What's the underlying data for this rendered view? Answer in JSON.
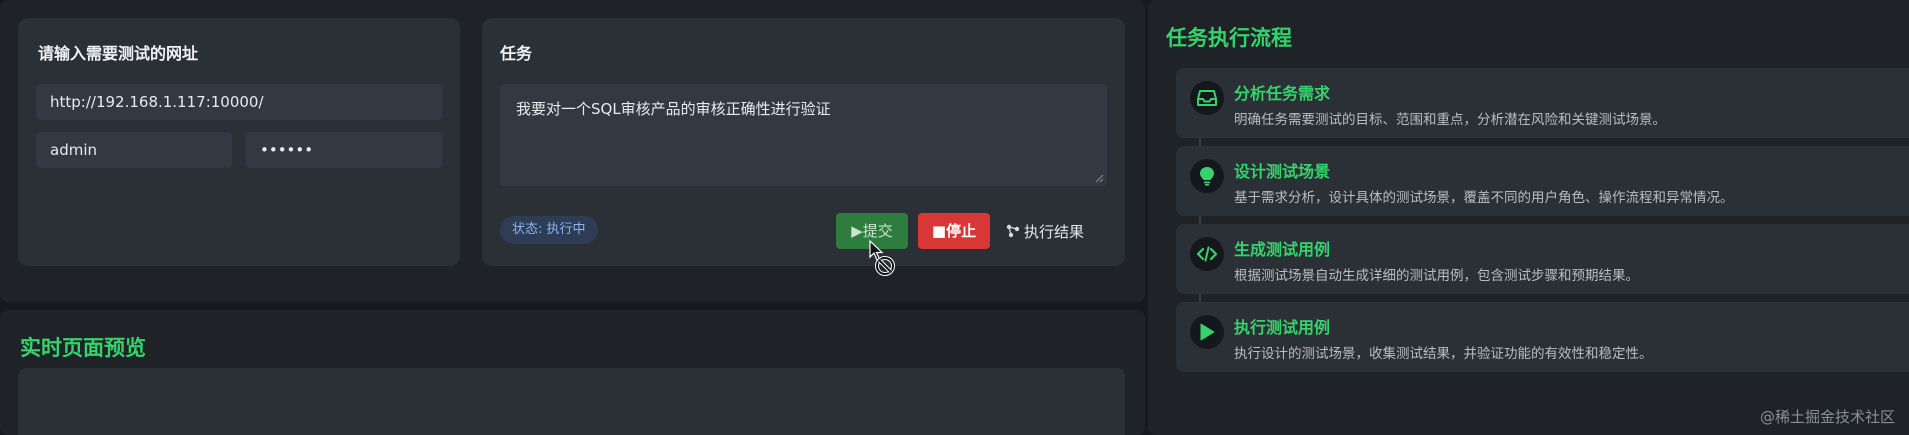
{
  "url_card": {
    "title": "请输入需要测试的网址",
    "url_value": "http://192.168.1.117:10000/",
    "username_value": "admin",
    "password_value": "••••••"
  },
  "task_card": {
    "title": "任务",
    "task_text": "我要对一个SQL审核产品的审核正确性进行验证",
    "status": "状态: 执行中",
    "submit_label": "▶提交",
    "stop_label": "■停止",
    "result_label": "执行结果"
  },
  "preview": {
    "title": "实时页面预览"
  },
  "flow": {
    "title": "任务执行流程",
    "steps": [
      {
        "title": "分析任务需求",
        "desc": "明确任务需要测试的目标、范围和重点，分析潜在风险和关键测试场景。",
        "icon": "inbox-icon"
      },
      {
        "title": "设计测试场景",
        "desc": "基于需求分析，设计具体的测试场景，覆盖不同的用户角色、操作流程和异常情况。",
        "icon": "lightbulb-icon"
      },
      {
        "title": "生成测试用例",
        "desc": "根据测试场景自动生成详细的测试用例，包含测试步骤和预期结果。",
        "icon": "code-icon"
      },
      {
        "title": "执行测试用例",
        "desc": "执行设计的测试场景，收集测试结果，并验证功能的有效性和稳定性。",
        "icon": "play-icon"
      }
    ]
  },
  "watermark": "@稀土掘金技术社区",
  "colors": {
    "accent_green": "#35d36b",
    "submit_green": "#2e7d3f",
    "stop_red": "#d93636",
    "status_blue": "#8db4ee"
  }
}
